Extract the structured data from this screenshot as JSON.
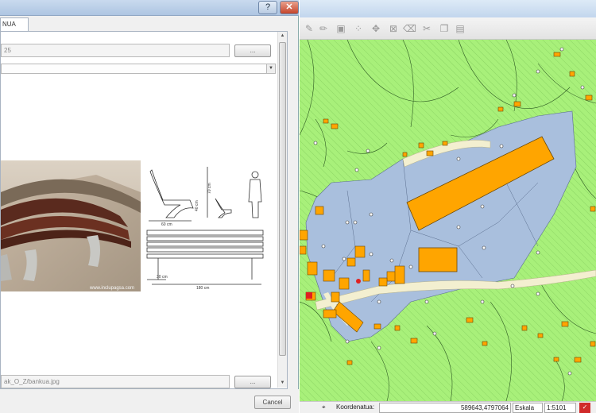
{
  "dialog": {
    "help_label": "?",
    "close_label": "✕",
    "tab_label": "NUA",
    "field1_value": "25",
    "browse1_label": "...",
    "image_path_value": "ak_O_Z/bankua.jpg",
    "browse2_label": "...",
    "cancel_label": "Cancel",
    "photo_watermark": "www.inclupagsa.com",
    "drawing": {
      "dim_height_outer": "70 cm",
      "dim_height_inner": "40 cm",
      "dim_depth": "60 cm",
      "dim_leg": "30 cm",
      "dim_length": "180 cm"
    }
  },
  "gis": {
    "toolbar_icons": [
      "pencil-icon",
      "pencil-alt-icon",
      "save-icon",
      "node-tool-icon",
      "move-feature-icon",
      "delete-selected-icon",
      "cut-features-icon",
      "copy-features-icon",
      "paste-features-icon"
    ],
    "status": {
      "coordinate_label": "Koordenatua:",
      "coordinate_value": "589643,4797064",
      "scale_label": "Eskala",
      "scale_value": "1:5101"
    },
    "colors": {
      "farmland": "#a8f07a",
      "urban": "#a9bfdd",
      "building": "#ffa500",
      "road": "#f3efd0"
    }
  }
}
